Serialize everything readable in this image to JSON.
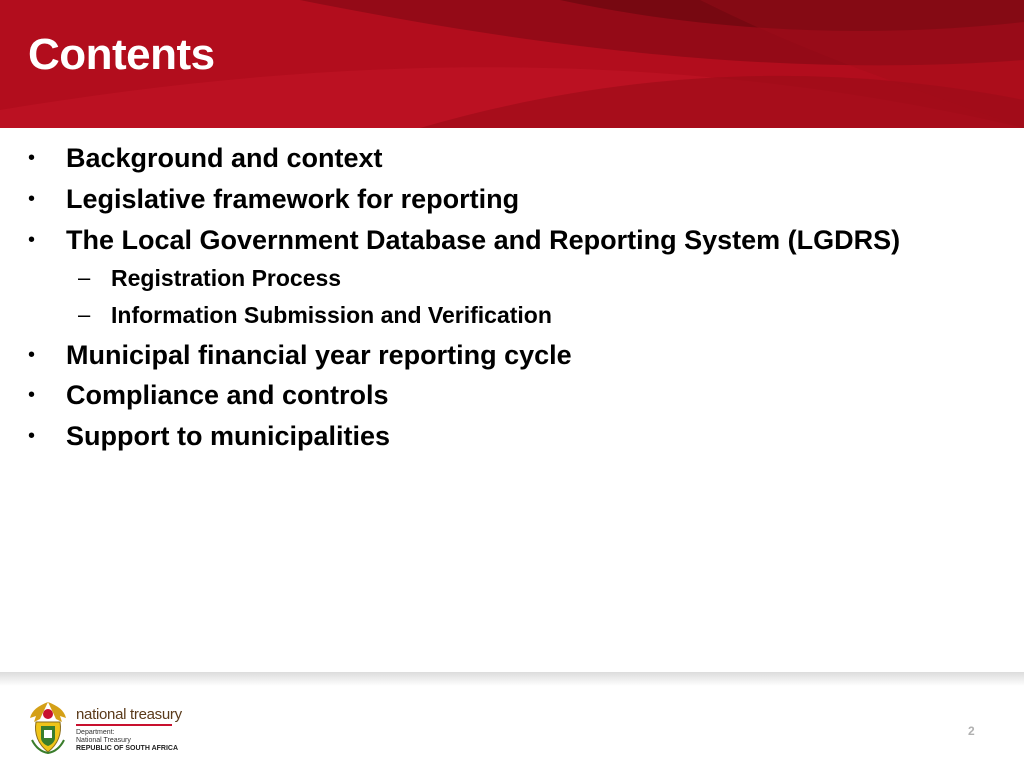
{
  "slide": {
    "title": "Contents"
  },
  "contents": {
    "items": [
      {
        "label": "Background and context",
        "level": 1
      },
      {
        "label": "Legislative framework for reporting",
        "level": 1
      },
      {
        "label": "The Local Government Database and Reporting System (LGDRS)",
        "level": 1
      },
      {
        "label": "Registration Process",
        "level": 2
      },
      {
        "label": "Information Submission and Verification",
        "level": 2
      },
      {
        "label": "Municipal financial year reporting cycle",
        "level": 1
      },
      {
        "label": "Compliance and controls",
        "level": 1
      },
      {
        "label": "Support to municipalities",
        "level": 1
      }
    ],
    "bullet_glyph": "•",
    "sub_bullet_glyph": "–"
  },
  "footer": {
    "logo_name": "national treasury",
    "dept_label": "Department:",
    "dept_name": "National Treasury",
    "country": "REPUBLIC OF SOUTH AFRICA",
    "page_number": "2"
  },
  "colors": {
    "header_red": "#b20d1d",
    "header_dark": "#7d0a12",
    "header_light": "#c8142a"
  }
}
